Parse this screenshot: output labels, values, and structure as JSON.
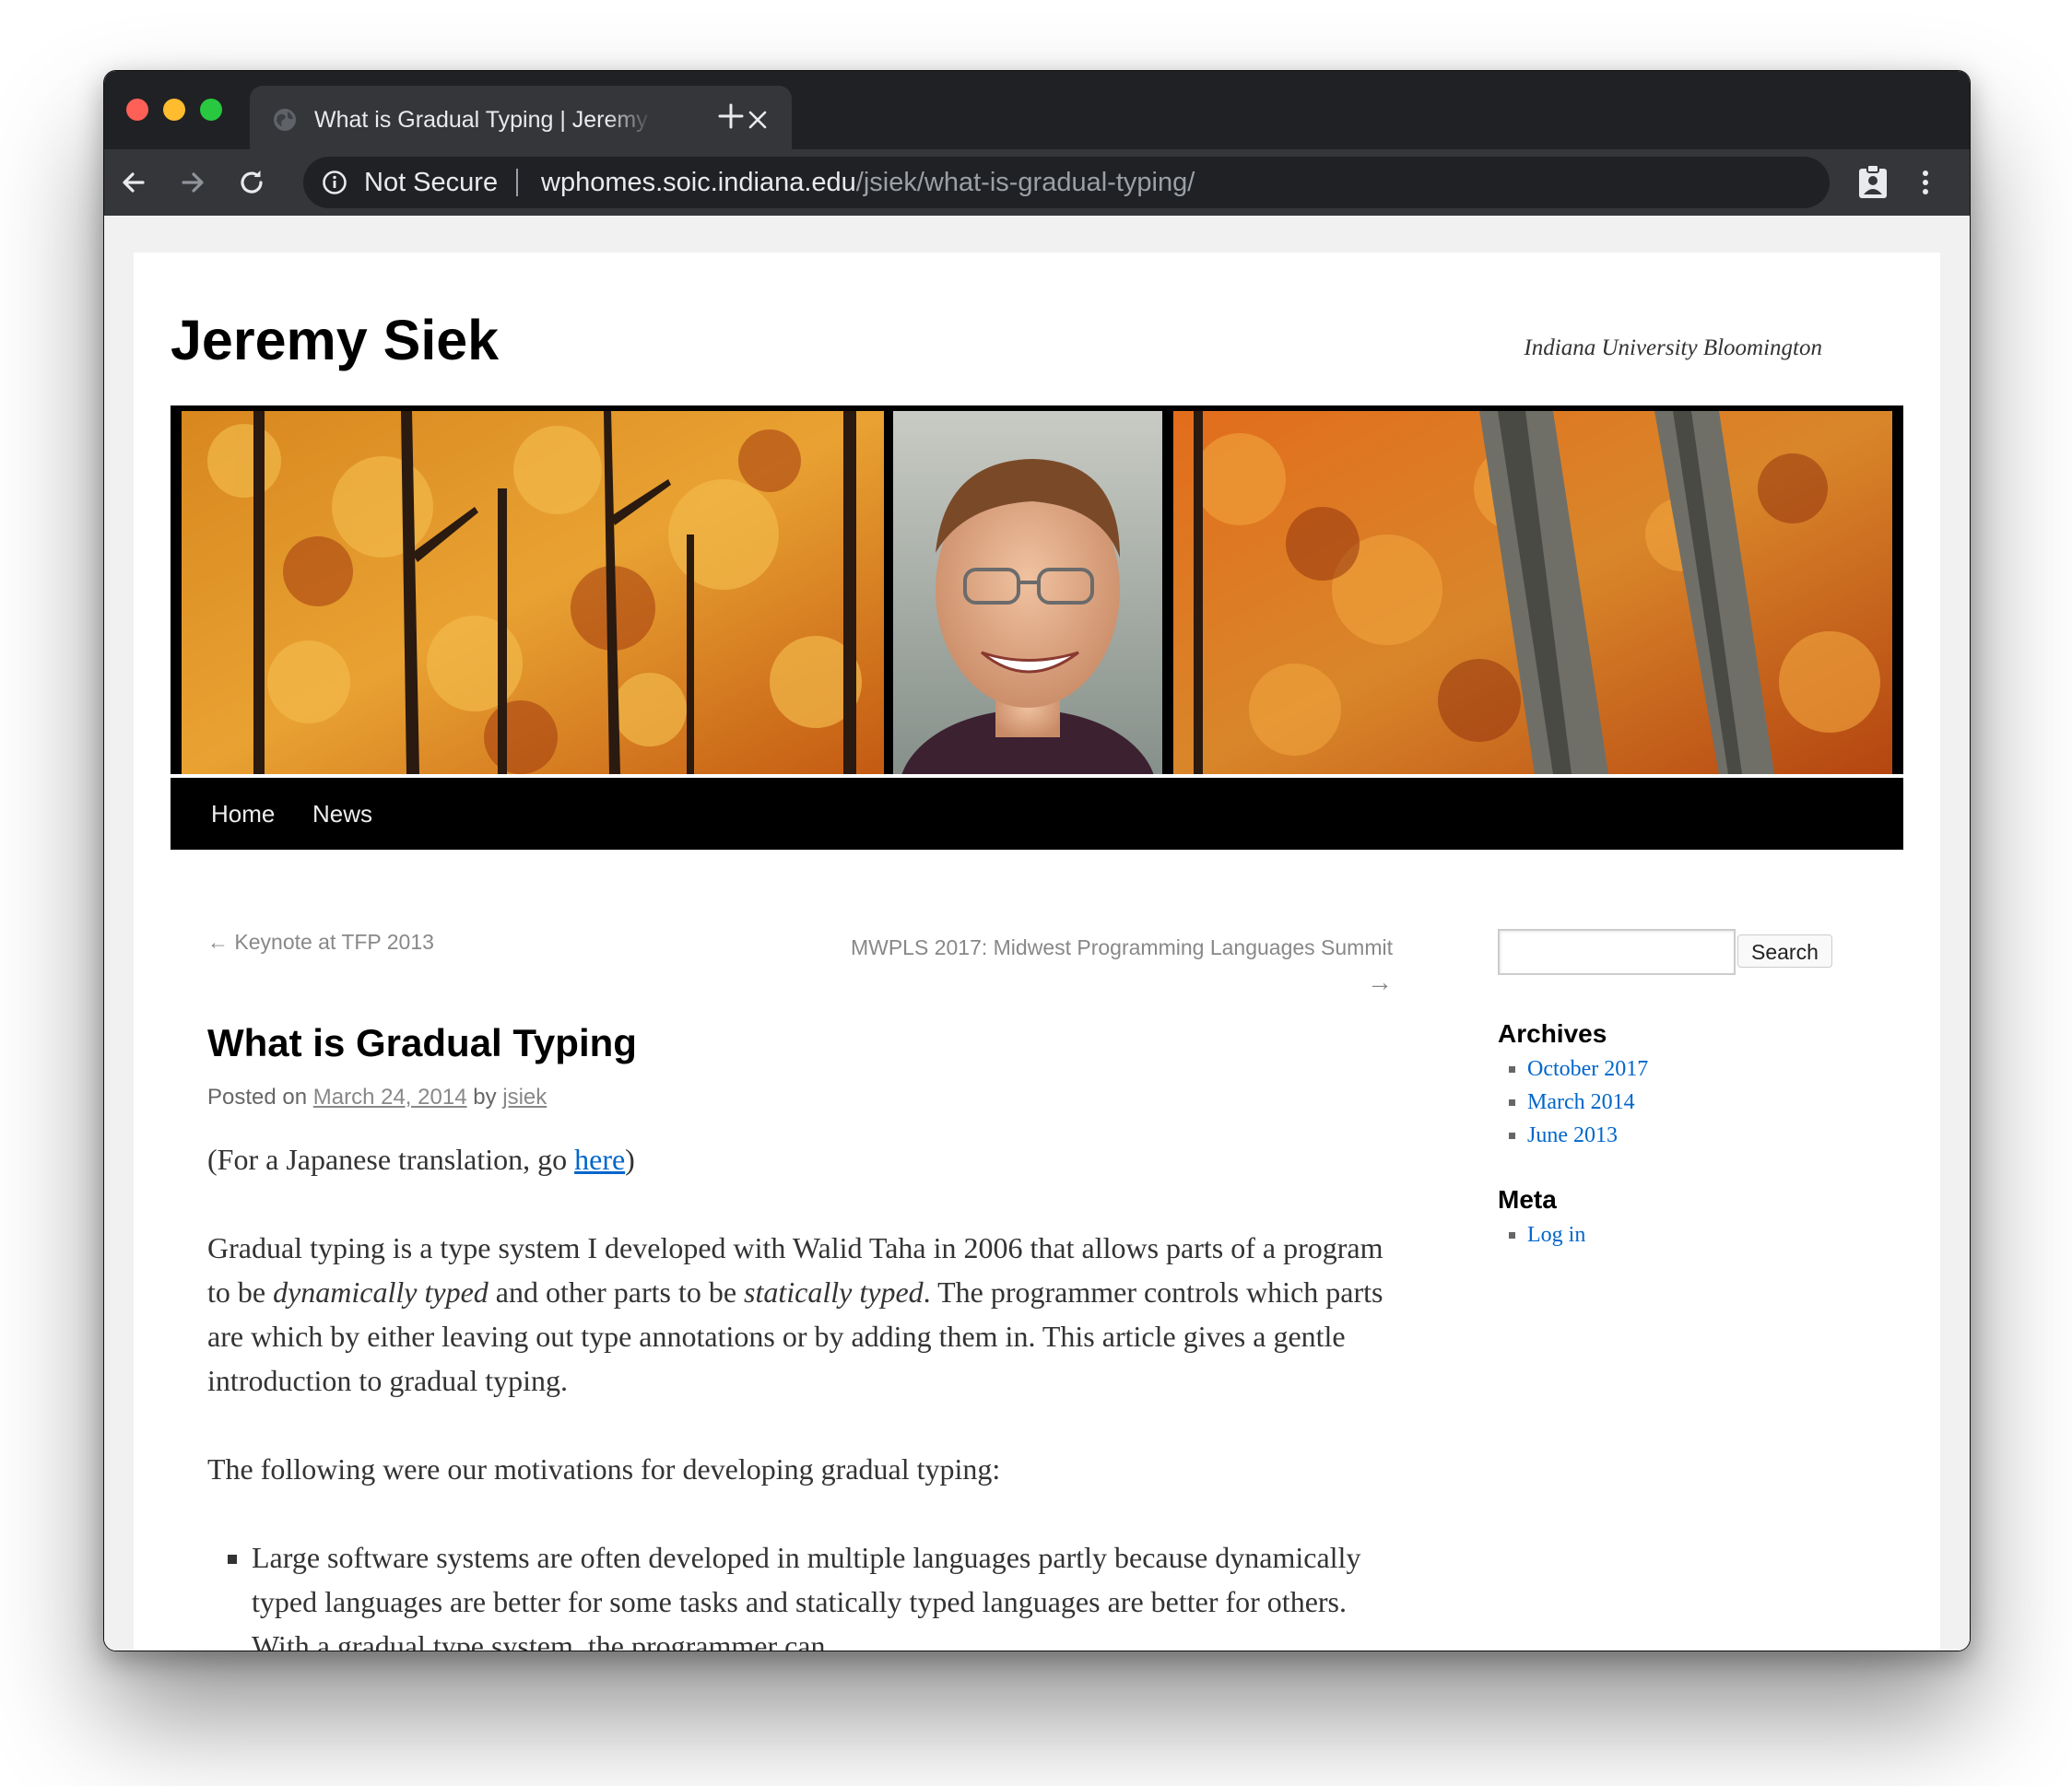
{
  "browser": {
    "tab_title": "What is Gradual Typing | Jeremy Siek",
    "security_label": "Not Secure",
    "url_host": "wphomes.soic.indiana.edu",
    "url_path": "/jsiek/what-is-gradual-typing/",
    "icons": [
      "back-icon",
      "forward-icon",
      "reload-icon",
      "info-icon",
      "profile-icon",
      "menu-icon",
      "close-icon",
      "plus-icon"
    ]
  },
  "site": {
    "title": "Jeremy Siek",
    "description": "Indiana University Bloomington"
  },
  "nav": {
    "items": [
      {
        "label": "Home"
      },
      {
        "label": "News"
      }
    ]
  },
  "post_nav": {
    "previous": "← Keynote at TFP 2013",
    "next_line1": "MWPLS 2017: Midwest Programming Languages Summit",
    "next_line2": "→"
  },
  "post": {
    "title": "What is Gradual Typing",
    "meta_prefix": "Posted on",
    "date": "March 24, 2014",
    "meta_by": "by",
    "author": "jsiek",
    "translation_prefix": "(For a Japanese translation, go ",
    "translation_link": "here",
    "translation_suffix": ")",
    "intro_1": "Gradual typing is a type system I developed with Walid Taha in 2006 that allows parts of a program to be ",
    "intro_em1": "dynamically typed",
    "intro_2": " and other parts to be ",
    "intro_em2": "statically typed",
    "intro_3": ". The programmer controls which parts are which by either leaving out type annotations or by adding them in. This article gives a gentle introduction to gradual typing.",
    "motivations": "The following were our motivations for developing gradual typing:",
    "bullet_1": "Large software systems are often developed in multiple languages partly because dynamically typed languages are better for some tasks and statically typed languages are better for others. With a gradual type system, the programmer can"
  },
  "sidebar": {
    "search_button": "Search",
    "search_value": "",
    "archives_title": "Archives",
    "archives": [
      {
        "label": "October 2017"
      },
      {
        "label": "March 2014"
      },
      {
        "label": "June 2013"
      }
    ],
    "meta_title": "Meta",
    "meta_links": [
      {
        "label": "Log in"
      }
    ]
  },
  "colors": {
    "chrome_dark": "#202124",
    "chrome_toolbar": "#35363a",
    "link": "#0066cc",
    "nav_bar": "#000000"
  }
}
